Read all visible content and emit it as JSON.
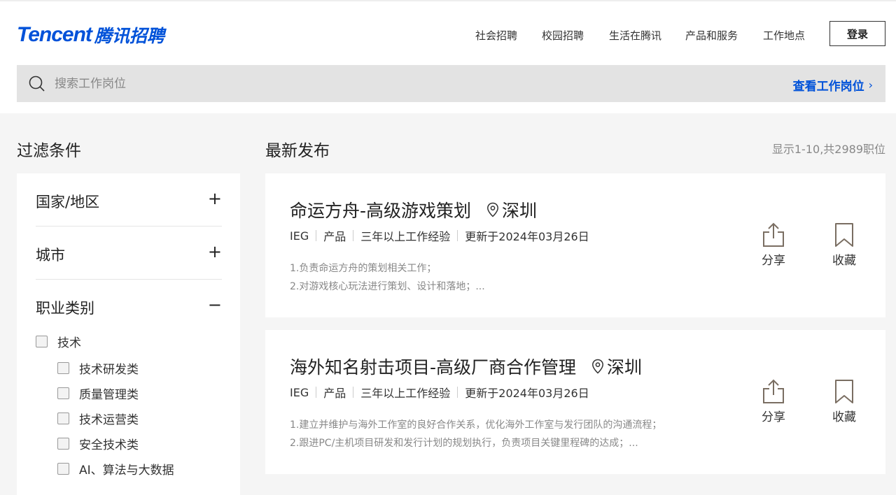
{
  "logo": {
    "en": "Tencent",
    "cn": "腾讯招聘"
  },
  "nav": [
    {
      "label": "社会招聘"
    },
    {
      "label": "校园招聘"
    },
    {
      "label": "生活在腾讯"
    },
    {
      "label": "产品和服务"
    },
    {
      "label": "工作地点"
    }
  ],
  "login_label": "登录",
  "search": {
    "placeholder": "搜索工作岗位",
    "value": "",
    "action_label": "查看工作岗位",
    "action_chevron": "›"
  },
  "filters": {
    "title": "过滤条件",
    "sections": [
      {
        "label": "国家/地区",
        "toggle": "+"
      },
      {
        "label": "城市",
        "toggle": "+"
      },
      {
        "label": "职业类别",
        "toggle": "−"
      }
    ],
    "category_parent": "技术",
    "subcategories": [
      "技术研发类",
      "质量管理类",
      "技术运营类",
      "安全技术类",
      "AI、算法与大数据"
    ]
  },
  "listing": {
    "title": "最新发布",
    "count": "显示1-10,共2989职位"
  },
  "jobs": [
    {
      "title": "命运方舟-高级游戏策划",
      "location": "深圳",
      "meta": [
        "IEG",
        "产品",
        "三年以上工作经验",
        "更新于2024年03月26日"
      ],
      "desc": [
        "1.负责命运方舟的策划相关工作；",
        "2.对游戏核心玩法进行策划、设计和落地；..."
      ],
      "share_label": "分享",
      "save_label": "收藏"
    },
    {
      "title": "海外知名射击项目-高级厂商合作管理",
      "location": "深圳",
      "meta": [
        "IEG",
        "产品",
        "三年以上工作经验",
        "更新于2024年03月26日"
      ],
      "desc": [
        "1.建立并维护与海外工作室的良好合作关系，优化海外工作室与发行团队的沟通流程；",
        "2.跟进PC/主机项目研发和发行计划的规划执行，负责项目关键里程碑的达成；..."
      ],
      "share_label": "分享",
      "save_label": "收藏"
    }
  ],
  "colors": {
    "brand": "#0052d9",
    "search_bg": "#e3e3e3",
    "page_bg": "#f5f5f5"
  }
}
